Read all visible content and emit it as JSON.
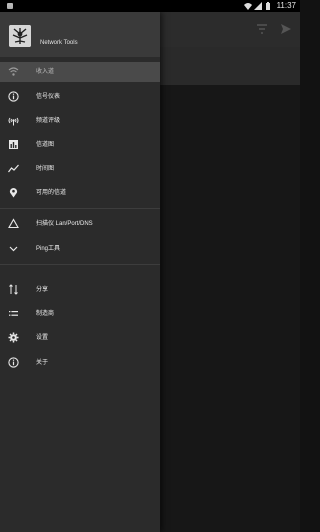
{
  "status_bar": {
    "time": "11:37"
  },
  "drawer": {
    "app_name": "Network Tools",
    "items": [
      {
        "label": "收入道",
        "icon": "wifi-icon"
      },
      {
        "label": "信号仪表",
        "icon": "info-circle-icon"
      },
      {
        "label": "频道评级",
        "icon": "hotspot-icon"
      },
      {
        "label": "信道图",
        "icon": "bar-chart-icon"
      },
      {
        "label": "时间图",
        "icon": "line-chart-icon"
      },
      {
        "label": "可用的信道",
        "icon": "location-pin-icon"
      },
      {
        "label": "扫描仪 Lan/Port/DNS",
        "icon": "triangle-icon"
      },
      {
        "label": "Ping工具",
        "icon": "chevron-down-icon"
      },
      {
        "label": "分享",
        "icon": "sort-icon"
      },
      {
        "label": "制造商",
        "icon": "list-icon"
      },
      {
        "label": "设置",
        "icon": "gear-icon"
      },
      {
        "label": "关于",
        "icon": "info-circle-icon"
      }
    ]
  },
  "colors": {
    "drawer_bg": "#2b2b2b",
    "header_bg": "#3a3a3a",
    "selected_bg": "#4a4a4a",
    "content_bg": "#171717"
  }
}
